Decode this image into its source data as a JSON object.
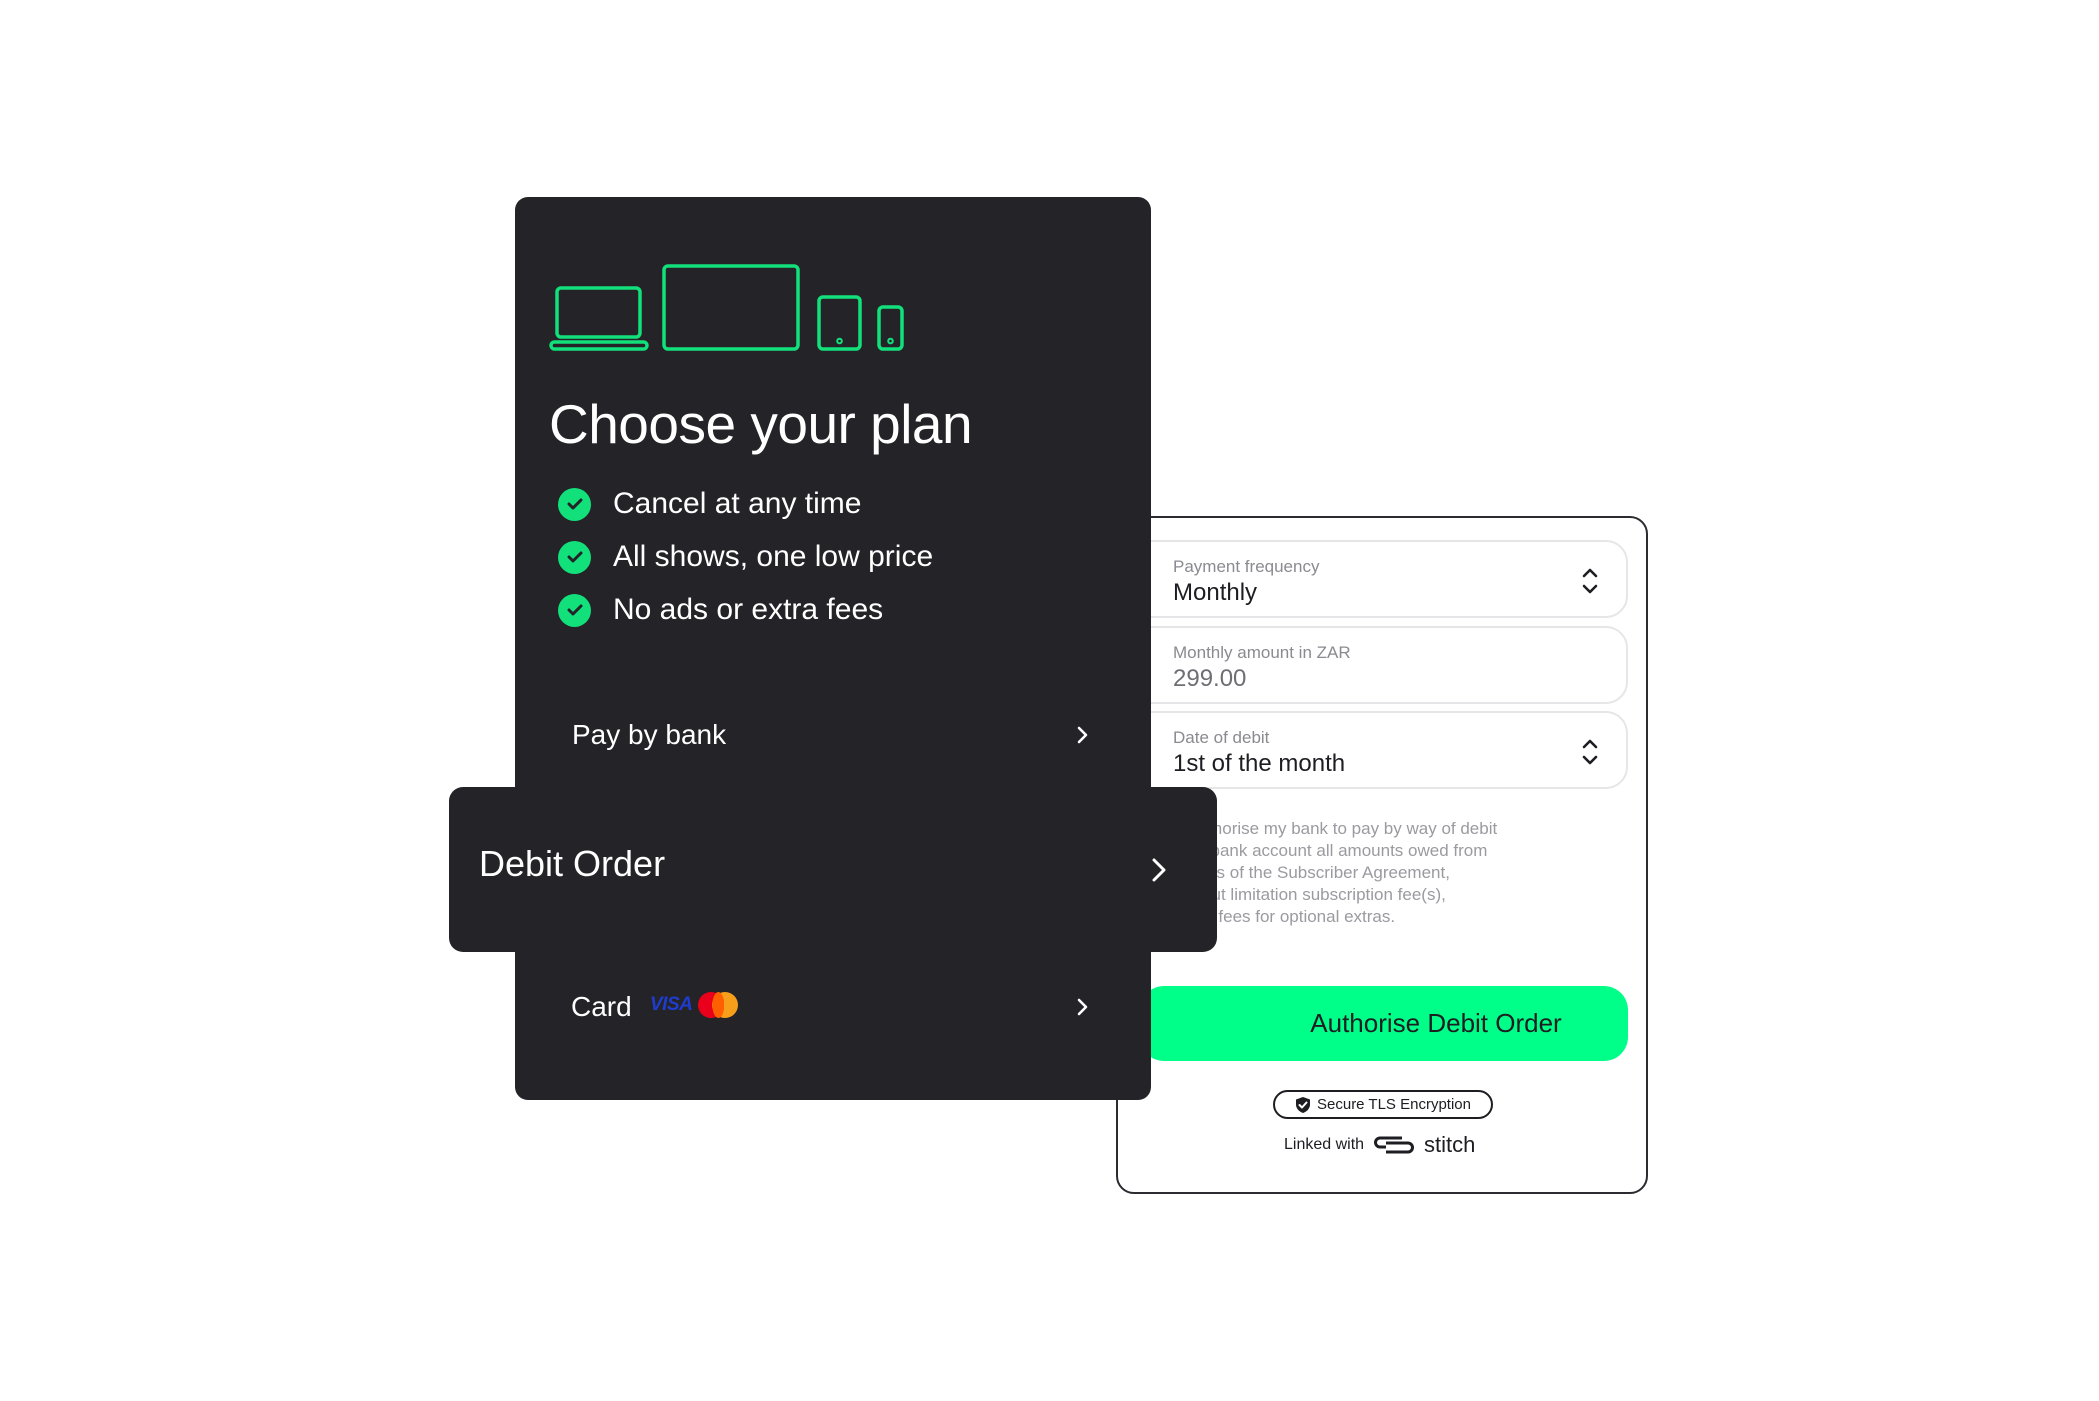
{
  "colors": {
    "accent_green": "#00ff88",
    "card_dark": "#232328",
    "icon_green": "#12e07a",
    "visa_blue": "#1f3ccf",
    "mastercard_red": "#eb001b",
    "mastercard_orange": "#f79e1b"
  },
  "plan_card": {
    "device_icons": [
      "laptop-icon",
      "tv-icon",
      "tablet-icon",
      "phone-icon"
    ],
    "heading": "Choose your plan",
    "features": [
      {
        "icon": "check-circle-icon",
        "text": "Cancel at any time"
      },
      {
        "icon": "check-circle-icon",
        "text": "All shows, one low price"
      },
      {
        "icon": "check-circle-icon",
        "text": "No ads or extra fees"
      }
    ],
    "payment_options": {
      "pay_by_bank": {
        "label": "Pay by bank",
        "icon": "chevron-right-icon"
      },
      "debit_order": {
        "label": "Debit Order",
        "icon": "chevron-right-icon"
      },
      "card": {
        "label": "Card",
        "logos": [
          "VISA",
          "Mastercard"
        ],
        "visa_text": "VISA",
        "icon": "chevron-right-icon"
      }
    }
  },
  "debit_form": {
    "fields": [
      {
        "label": "Payment frequency",
        "value": "Monthly",
        "type": "select",
        "icon": "updown-chevron-icon"
      },
      {
        "label": "Monthly amount in ZAR",
        "value": "299.00",
        "type": "readonly"
      },
      {
        "label": "Date of debit",
        "value": "1st of the month",
        "type": "select",
        "icon": "updown-chevron-icon"
      }
    ],
    "consent_lines": [
      "I hereby authorise my bank to pay by way of debit",
      "order from my bank account all amounts owed from",
      "time to time in terms of the Subscriber Agreement,",
      "including without limitation subscription fee(s),",
      "registration fees, fees for optional extras."
    ],
    "submit_label": "Authorise Debit Order",
    "security_badge": "Secure TLS Encryption",
    "linked_with": "Linked with",
    "partner_brand": "stitch"
  }
}
